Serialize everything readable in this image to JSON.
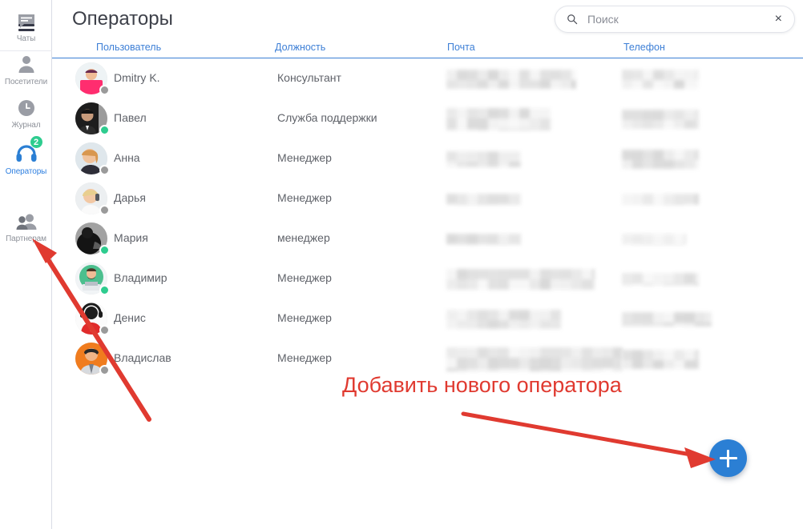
{
  "header": {
    "title": "Операторы",
    "menu_icon": "hamburger-icon"
  },
  "search": {
    "placeholder": "Поиск",
    "value": "",
    "icon": "search-icon",
    "clear_icon": "close-icon",
    "clear_glyph": "×"
  },
  "sidebar": {
    "items": [
      {
        "label": "Чаты",
        "icon": "chat-icon",
        "active": false,
        "badge": ""
      },
      {
        "label": "Посетители",
        "icon": "user-icon",
        "active": false,
        "badge": ""
      },
      {
        "label": "Журнал",
        "icon": "clock-icon",
        "active": false,
        "badge": ""
      },
      {
        "label": "Операторы",
        "icon": "headset-icon",
        "active": true,
        "badge": "2"
      },
      {
        "label": "Партнерам",
        "icon": "people-icon",
        "active": false,
        "badge": ""
      }
    ]
  },
  "table": {
    "columns": [
      "Пользователь",
      "Должность",
      "Почта",
      "Телефон"
    ],
    "rows": [
      {
        "name": "Dmitry K.",
        "role": "Консультант",
        "status": "offline",
        "email": "",
        "phone": ""
      },
      {
        "name": "Павел",
        "role": "Служба поддержки",
        "status": "online",
        "email": "",
        "phone": ""
      },
      {
        "name": "Анна",
        "role": "Менеджер",
        "status": "offline",
        "email": "",
        "phone": ""
      },
      {
        "name": "Дарья",
        "role": "Менеджер",
        "status": "offline",
        "email": "",
        "phone": ""
      },
      {
        "name": "Мария",
        "role": "менеджер",
        "status": "online",
        "email": "",
        "phone": ""
      },
      {
        "name": "Владимир",
        "role": "Менеджер",
        "status": "online",
        "email": "",
        "phone": ""
      },
      {
        "name": "Денис",
        "role": "Менеджер",
        "status": "offline",
        "email": "",
        "phone": ""
      },
      {
        "name": "Владислав",
        "role": "Менеджер",
        "status": "offline",
        "email": "",
        "phone": ""
      }
    ]
  },
  "fab": {
    "icon": "plus-icon",
    "label": ""
  },
  "annotation": {
    "text": "Добавить нового оператора",
    "color": "#e03a30"
  },
  "colors": {
    "accent_blue": "#2b7fd4",
    "header_link_blue": "#3d7fd6",
    "online_green": "#2ecc8f",
    "offline_grey": "#9a9a9a",
    "annotation_red": "#e03a30",
    "text_grey": "#5f6269"
  }
}
